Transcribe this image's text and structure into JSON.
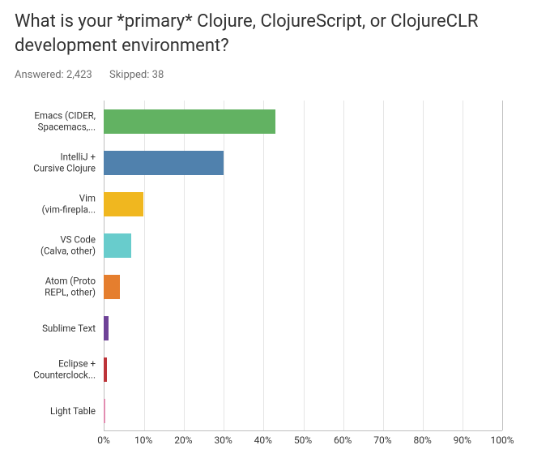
{
  "title": "What is your *primary* Clojure, ClojureScript, or ClojureCLR development environment?",
  "meta": {
    "answered_label": "Answered:",
    "answered_count": "2,423",
    "skipped_label": "Skipped:",
    "skipped_count": "38"
  },
  "chart_data": {
    "type": "bar",
    "orientation": "horizontal",
    "xlabel": "",
    "ylabel": "",
    "xlim": [
      0,
      100
    ],
    "unit": "%",
    "categories": [
      "Emacs (CIDER,\nSpacemacs,...",
      "IntelliJ +\nCursive Clojure",
      "Vim\n(vim-firepla...",
      "VS Code\n(Calva, other)",
      "Atom (Proto\nREPL, other)",
      "Sublime Text",
      "Eclipse +\nCounterclock...",
      "Light Table"
    ],
    "values": [
      43,
      30,
      10,
      7,
      4,
      1.3,
      0.8,
      0.4
    ],
    "colors": [
      "#62b262",
      "#5081ad",
      "#f0b71f",
      "#68cccc",
      "#e57e2e",
      "#6e4297",
      "#bd3439",
      "#e28db1"
    ],
    "x_ticks": [
      0,
      10,
      20,
      30,
      40,
      50,
      60,
      70,
      80,
      90,
      100
    ]
  }
}
